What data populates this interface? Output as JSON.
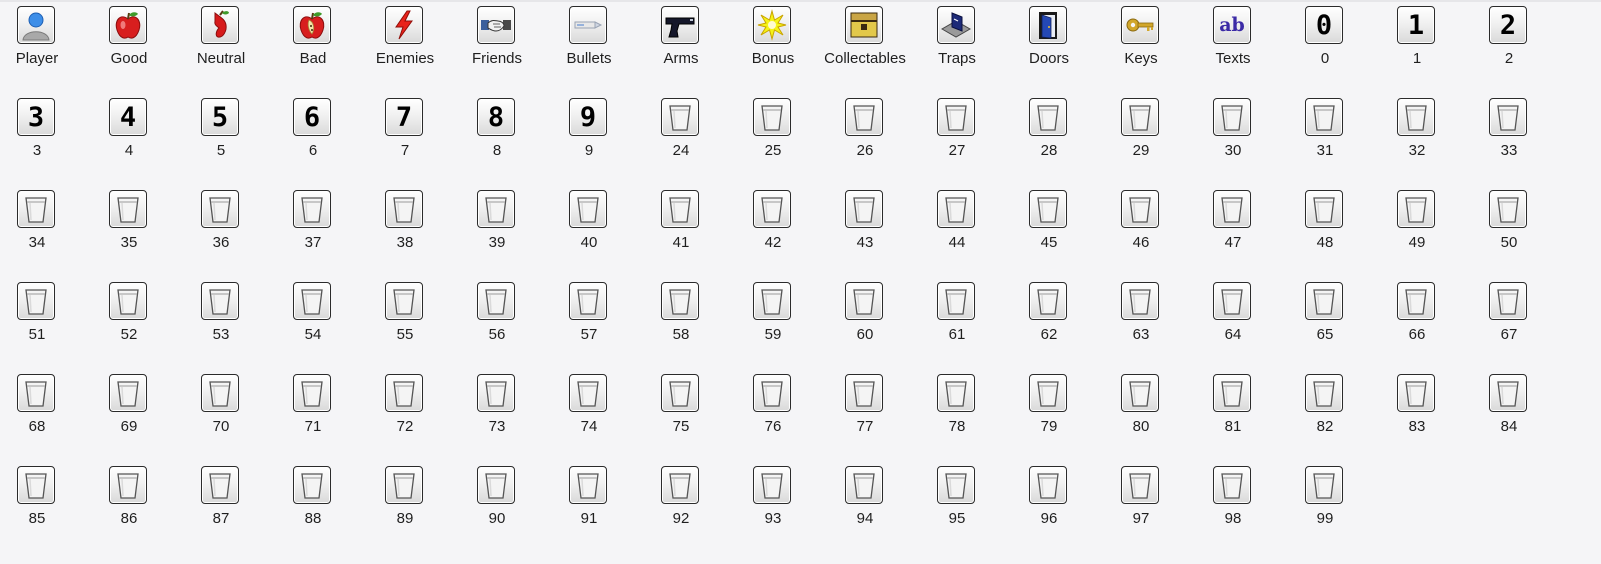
{
  "cells": [
    {
      "label": "Player",
      "icon": "player-icon"
    },
    {
      "label": "Good",
      "icon": "apple-icon"
    },
    {
      "label": "Neutral",
      "icon": "neutral-icon"
    },
    {
      "label": "Bad",
      "icon": "bad-apple-icon"
    },
    {
      "label": "Enemies",
      "icon": "lightning-icon"
    },
    {
      "label": "Friends",
      "icon": "handshake-icon"
    },
    {
      "label": "Bullets",
      "icon": "bullet-icon"
    },
    {
      "label": "Arms",
      "icon": "pistol-icon"
    },
    {
      "label": "Bonus",
      "icon": "star-burst-icon"
    },
    {
      "label": "Collectables",
      "icon": "treasure-chest-icon"
    },
    {
      "label": "Traps",
      "icon": "trap-icon"
    },
    {
      "label": "Doors",
      "icon": "door-icon"
    },
    {
      "label": "Keys",
      "icon": "key-icon"
    },
    {
      "label": "Texts",
      "icon": "text-ab-icon",
      "glyph": "ab"
    },
    {
      "label": "0",
      "icon": "digit-0-icon",
      "glyph": "0"
    },
    {
      "label": "1",
      "icon": "digit-1-icon",
      "glyph": "1"
    },
    {
      "label": "2",
      "icon": "digit-2-icon",
      "glyph": "2"
    },
    {
      "label": "3",
      "icon": "digit-3-icon",
      "glyph": "3"
    },
    {
      "label": "4",
      "icon": "digit-4-icon",
      "glyph": "4"
    },
    {
      "label": "5",
      "icon": "digit-5-icon",
      "glyph": "5"
    },
    {
      "label": "6",
      "icon": "digit-6-icon",
      "glyph": "6"
    },
    {
      "label": "7",
      "icon": "digit-7-icon",
      "glyph": "7"
    },
    {
      "label": "8",
      "icon": "digit-8-icon",
      "glyph": "8"
    },
    {
      "label": "9",
      "icon": "digit-9-icon",
      "glyph": "9"
    },
    {
      "label": "24",
      "icon": "empty-glass-icon"
    },
    {
      "label": "25",
      "icon": "empty-glass-icon"
    },
    {
      "label": "26",
      "icon": "empty-glass-icon"
    },
    {
      "label": "27",
      "icon": "empty-glass-icon"
    },
    {
      "label": "28",
      "icon": "empty-glass-icon"
    },
    {
      "label": "29",
      "icon": "empty-glass-icon"
    },
    {
      "label": "30",
      "icon": "empty-glass-icon"
    },
    {
      "label": "31",
      "icon": "empty-glass-icon"
    },
    {
      "label": "32",
      "icon": "empty-glass-icon"
    },
    {
      "label": "33",
      "icon": "empty-glass-icon"
    },
    {
      "label": "34",
      "icon": "empty-glass-icon"
    },
    {
      "label": "35",
      "icon": "empty-glass-icon"
    },
    {
      "label": "36",
      "icon": "empty-glass-icon"
    },
    {
      "label": "37",
      "icon": "empty-glass-icon"
    },
    {
      "label": "38",
      "icon": "empty-glass-icon"
    },
    {
      "label": "39",
      "icon": "empty-glass-icon"
    },
    {
      "label": "40",
      "icon": "empty-glass-icon"
    },
    {
      "label": "41",
      "icon": "empty-glass-icon"
    },
    {
      "label": "42",
      "icon": "empty-glass-icon"
    },
    {
      "label": "43",
      "icon": "empty-glass-icon"
    },
    {
      "label": "44",
      "icon": "empty-glass-icon"
    },
    {
      "label": "45",
      "icon": "empty-glass-icon"
    },
    {
      "label": "46",
      "icon": "empty-glass-icon"
    },
    {
      "label": "47",
      "icon": "empty-glass-icon"
    },
    {
      "label": "48",
      "icon": "empty-glass-icon"
    },
    {
      "label": "49",
      "icon": "empty-glass-icon"
    },
    {
      "label": "50",
      "icon": "empty-glass-icon"
    },
    {
      "label": "51",
      "icon": "empty-glass-icon"
    },
    {
      "label": "52",
      "icon": "empty-glass-icon"
    },
    {
      "label": "53",
      "icon": "empty-glass-icon"
    },
    {
      "label": "54",
      "icon": "empty-glass-icon"
    },
    {
      "label": "55",
      "icon": "empty-glass-icon"
    },
    {
      "label": "56",
      "icon": "empty-glass-icon"
    },
    {
      "label": "57",
      "icon": "empty-glass-icon"
    },
    {
      "label": "58",
      "icon": "empty-glass-icon"
    },
    {
      "label": "59",
      "icon": "empty-glass-icon"
    },
    {
      "label": "60",
      "icon": "empty-glass-icon"
    },
    {
      "label": "61",
      "icon": "empty-glass-icon"
    },
    {
      "label": "62",
      "icon": "empty-glass-icon"
    },
    {
      "label": "63",
      "icon": "empty-glass-icon"
    },
    {
      "label": "64",
      "icon": "empty-glass-icon"
    },
    {
      "label": "65",
      "icon": "empty-glass-icon"
    },
    {
      "label": "66",
      "icon": "empty-glass-icon"
    },
    {
      "label": "67",
      "icon": "empty-glass-icon"
    },
    {
      "label": "68",
      "icon": "empty-glass-icon"
    },
    {
      "label": "69",
      "icon": "empty-glass-icon"
    },
    {
      "label": "70",
      "icon": "empty-glass-icon"
    },
    {
      "label": "71",
      "icon": "empty-glass-icon"
    },
    {
      "label": "72",
      "icon": "empty-glass-icon"
    },
    {
      "label": "73",
      "icon": "empty-glass-icon"
    },
    {
      "label": "74",
      "icon": "empty-glass-icon"
    },
    {
      "label": "75",
      "icon": "empty-glass-icon"
    },
    {
      "label": "76",
      "icon": "empty-glass-icon"
    },
    {
      "label": "77",
      "icon": "empty-glass-icon"
    },
    {
      "label": "78",
      "icon": "empty-glass-icon"
    },
    {
      "label": "79",
      "icon": "empty-glass-icon"
    },
    {
      "label": "80",
      "icon": "empty-glass-icon"
    },
    {
      "label": "81",
      "icon": "empty-glass-icon"
    },
    {
      "label": "82",
      "icon": "empty-glass-icon"
    },
    {
      "label": "83",
      "icon": "empty-glass-icon"
    },
    {
      "label": "84",
      "icon": "empty-glass-icon"
    },
    {
      "label": "85",
      "icon": "empty-glass-icon"
    },
    {
      "label": "86",
      "icon": "empty-glass-icon"
    },
    {
      "label": "87",
      "icon": "empty-glass-icon"
    },
    {
      "label": "88",
      "icon": "empty-glass-icon"
    },
    {
      "label": "89",
      "icon": "empty-glass-icon"
    },
    {
      "label": "90",
      "icon": "empty-glass-icon"
    },
    {
      "label": "91",
      "icon": "empty-glass-icon"
    },
    {
      "label": "92",
      "icon": "empty-glass-icon"
    },
    {
      "label": "93",
      "icon": "empty-glass-icon"
    },
    {
      "label": "94",
      "icon": "empty-glass-icon"
    },
    {
      "label": "95",
      "icon": "empty-glass-icon"
    },
    {
      "label": "96",
      "icon": "empty-glass-icon"
    },
    {
      "label": "97",
      "icon": "empty-glass-icon"
    },
    {
      "label": "98",
      "icon": "empty-glass-icon"
    },
    {
      "label": "99",
      "icon": "empty-glass-icon"
    }
  ]
}
